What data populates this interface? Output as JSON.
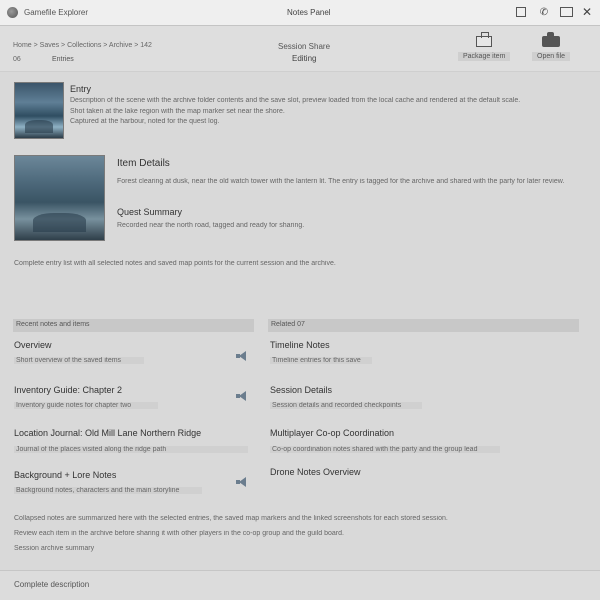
{
  "window": {
    "app_name": "Gamefile Explorer",
    "title": "Notes Panel"
  },
  "toolbar": {
    "breadcrumb": "Home > Saves > Collections > Archive > 142",
    "sub_left_a": "06",
    "sub_left_b": "Entries",
    "center_label": "Session Share",
    "center_value": "Editing",
    "action_1": "Package item",
    "action_2": "Open file"
  },
  "entries": [
    {
      "title": "Entry",
      "lines": [
        "Description of the scene with the archive folder contents and the save slot, preview loaded from the local cache and rendered at the default scale.",
        "Shot taken at the lake region with the map marker set near the shore.",
        "Captured at the harbour, noted for the quest log."
      ]
    },
    {
      "title": "Item Details",
      "line": "Forest clearing at dusk, near the old watch tower with the lantern lit. The entry is tagged for the archive and shared with the party for later review.",
      "subtitle": "Quest Summary",
      "subline": "Recorded near the north road, tagged and ready for sharing."
    }
  ],
  "paragraph": "Complete entry list with all selected notes and saved map points for the current session and the archive.",
  "sections": {
    "left_heading": "Recent notes and items",
    "right_heading": "Related 07"
  },
  "left_items": [
    {
      "title": "Overview",
      "sub": "Short overview of the saved items"
    },
    {
      "title": "Inventory Guide: Chapter 2",
      "sub": "Inventory guide notes for chapter two"
    },
    {
      "title": "Location Journal: Old Mill Lane Northern Ridge",
      "sub": "Journal of the places visited along the ridge path"
    },
    {
      "title": "Background + Lore Notes",
      "sub": "Background notes, characters and the main storyline"
    }
  ],
  "right_items": [
    {
      "title": "Timeline Notes",
      "sub": "Timeline entries for this save"
    },
    {
      "title": "Session Details",
      "sub": "Session details and recorded checkpoints"
    },
    {
      "title": "Multiplayer Co-op Coordination",
      "sub": "Co-op coordination notes shared with the party and the group lead"
    },
    {
      "title": "Drone Notes Overview",
      "sub": ""
    }
  ],
  "footer_lines": [
    "Collapsed notes are summarized here with the selected entries, the saved map markers and the linked screenshots for each stored session.",
    "Review each item in the archive before sharing it with other players in the co-op group and the guild board.",
    "Session archive summary"
  ],
  "status": "Complete description"
}
